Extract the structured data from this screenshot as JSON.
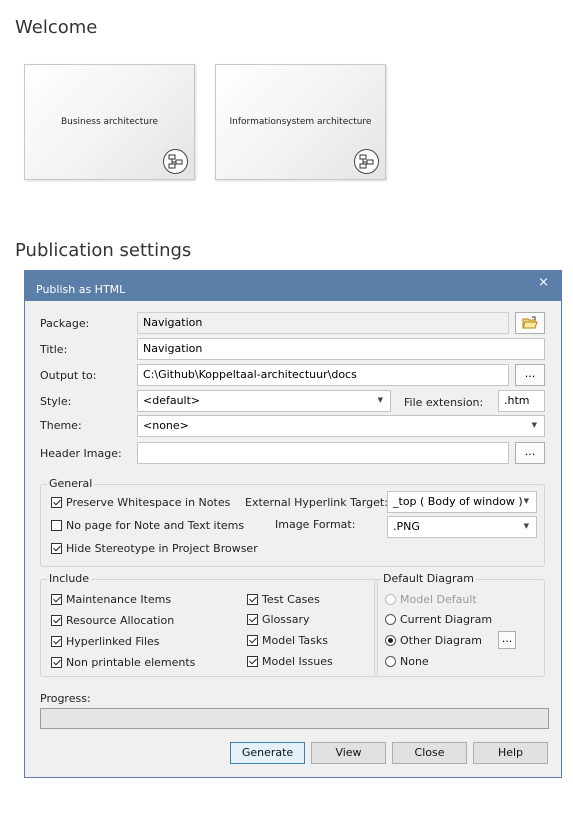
{
  "welcome": {
    "heading": "Welcome",
    "cards": [
      {
        "label": "Business architecture",
        "icon": "diagram-link-icon"
      },
      {
        "label": "Informationsystem architecture",
        "icon": "diagram-link-icon"
      }
    ]
  },
  "publication": {
    "heading": "Publication settings"
  },
  "dialog": {
    "title": "Publish as HTML",
    "close_glyph": "×",
    "package": {
      "label": "Package:",
      "value": "Navigation"
    },
    "title_field": {
      "label": "Title:",
      "value": "Navigation"
    },
    "output": {
      "label": "Output to:",
      "value": "C:\\Github\\Koppeltaal-architectuur\\docs",
      "browse": "..."
    },
    "style": {
      "label": "Style:",
      "value": "<default>"
    },
    "file_extension": {
      "label": "File extension:",
      "value": ".htm"
    },
    "theme": {
      "label": "Theme:",
      "value": "<none>"
    },
    "header_image": {
      "label": "Header Image:",
      "value": "",
      "browse": "..."
    },
    "general": {
      "title": "General",
      "preserve_whitespace": {
        "label": "Preserve Whitespace in Notes",
        "checked": true
      },
      "no_page_note": {
        "label": "No page for Note and Text items",
        "checked": false
      },
      "hide_stereotype": {
        "label": "Hide Stereotype in Project Browser",
        "checked": true
      },
      "hyperlink_target": {
        "label": "External Hyperlink Target:",
        "value": "_top  ( Body of window )"
      },
      "image_format": {
        "label": "Image Format:",
        "value": ".PNG"
      }
    },
    "include": {
      "title": "Include",
      "items": [
        {
          "label": "Maintenance Items",
          "checked": true
        },
        {
          "label": "Resource Allocation",
          "checked": true
        },
        {
          "label": "Hyperlinked Files",
          "checked": true
        },
        {
          "label": "Non printable elements",
          "checked": true
        },
        {
          "label": "Test Cases",
          "checked": true
        },
        {
          "label": "Glossary",
          "checked": true
        },
        {
          "label": "Model Tasks",
          "checked": true
        },
        {
          "label": "Model Issues",
          "checked": true
        }
      ]
    },
    "default_diagram": {
      "title": "Default Diagram",
      "options": [
        {
          "label": "Model Default",
          "selected": false,
          "disabled": true
        },
        {
          "label": "Current Diagram",
          "selected": false,
          "disabled": false
        },
        {
          "label": "Other Diagram",
          "selected": true,
          "disabled": false
        },
        {
          "label": "None",
          "selected": false,
          "disabled": false
        }
      ],
      "browse": "..."
    },
    "progress": {
      "label": "Progress:",
      "value": 0
    },
    "buttons": {
      "generate": "Generate",
      "view": "View",
      "close": "Close",
      "help": "Help"
    }
  }
}
